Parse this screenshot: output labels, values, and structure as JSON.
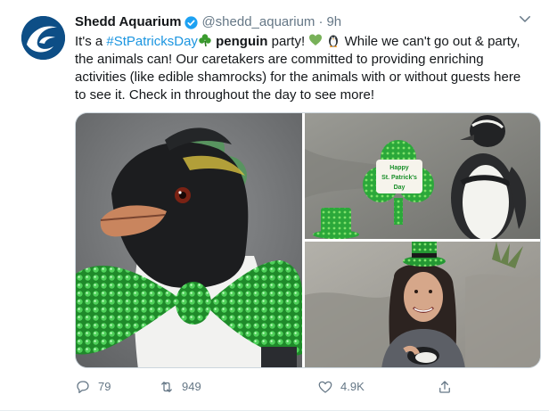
{
  "tweet": {
    "display_name": "Shedd Aquarium",
    "handle": "@shedd_aquarium",
    "separator": "·",
    "time": "9h",
    "text_parts": {
      "intro": "It's a ",
      "hashtag": "#StPatricksDay",
      "bold_word": "penguin",
      "after_bold": " party! ",
      "rest": " While we can't go out & party, the animals can! Our caretakers are committed to providing enriching activities (like edible shamrocks) for the animals with or without guests here to see it. Check in throughout the day to see more!"
    },
    "media_sign": {
      "line1": "Happy",
      "line2": "St. Patrick's",
      "line3": "Day"
    }
  },
  "actions": {
    "replies": "79",
    "retweets": "949",
    "likes": "4.9K"
  },
  "icons": [
    "shedd-logo-icon",
    "verified-icon",
    "chevron-down-icon",
    "shamrock-icon",
    "green-heart-icon",
    "penguin-icon",
    "reply-icon",
    "retweet-icon",
    "like-icon",
    "share-icon"
  ],
  "colors": {
    "accent": "#1b95e0",
    "text": "#14171a",
    "muted": "#657786",
    "verified": "#1da1f2"
  }
}
